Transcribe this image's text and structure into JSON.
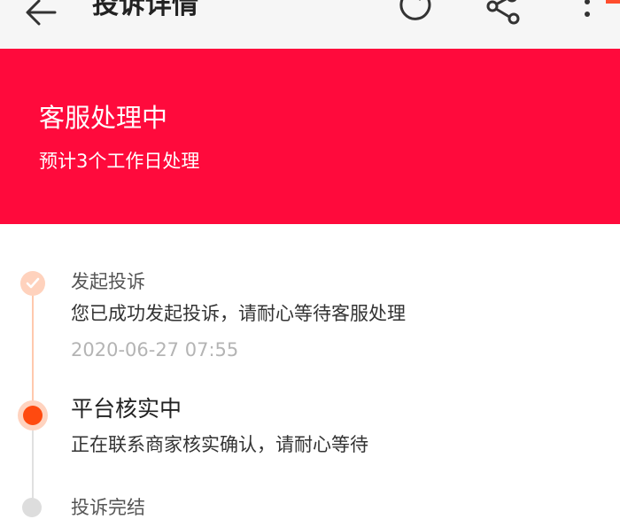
{
  "header": {
    "title": "投诉详情",
    "back_icon": "arrow-left-icon",
    "refresh_icon": "refresh-icon",
    "share_icon": "share-icon",
    "more_icon": "more-vertical-icon",
    "background_color": "#f6f6f6"
  },
  "status": {
    "title": "客服处理中",
    "subtitle": "预计3个工作日处理",
    "background_color": "#ff0a3c"
  },
  "timeline": {
    "accent_color": "#ff4a0f",
    "steps": [
      {
        "title": "发起投诉",
        "description": "您已成功发起投诉，请耐心等待客服处理",
        "time": "2020-06-27 07:55",
        "state": "done",
        "icon": "check-icon"
      },
      {
        "title": "平台核实中",
        "description": "正在联系商家核实确认，请耐心等待",
        "state": "active"
      },
      {
        "title": "投诉完结",
        "state": "pending"
      }
    ]
  }
}
